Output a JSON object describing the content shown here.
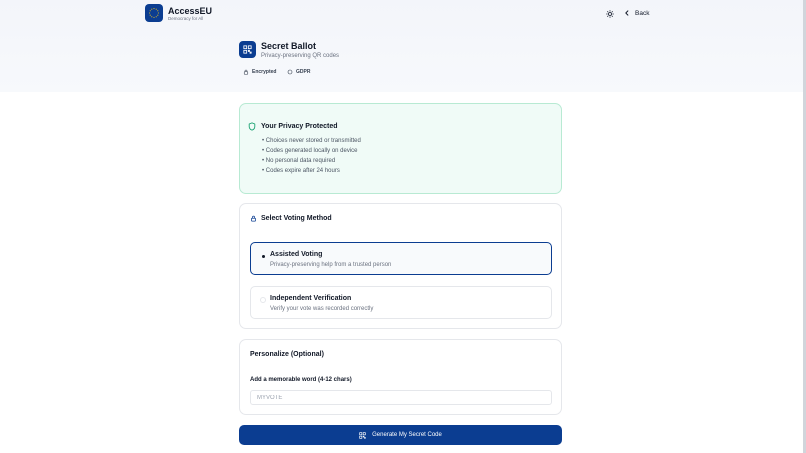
{
  "header": {
    "brand_name": "AccessEU",
    "brand_tagline": "Democracy for All",
    "back_label": "Back"
  },
  "page": {
    "title": "Secret Ballot",
    "subtitle": "Privacy-preserving QR codes",
    "badges": [
      "Encrypted",
      "GDPR"
    ]
  },
  "privacy": {
    "title": "Your Privacy Protected",
    "items": [
      "Choices never stored or transmitted",
      "Codes generated locally on device",
      "No personal data required",
      "Codes expire after 24 hours"
    ]
  },
  "voting_method": {
    "title": "Select Voting Method",
    "options": [
      {
        "label": "Assisted Voting",
        "description": "Privacy-preserving help from a trusted person",
        "selected": true
      },
      {
        "label": "Independent Verification",
        "description": "Verify your vote was recorded correctly",
        "selected": false
      }
    ]
  },
  "personalize": {
    "title": "Personalize (Optional)",
    "field_label": "Add a memorable word (4-12 chars)",
    "placeholder": "MYVOTE",
    "value": ""
  },
  "actions": {
    "generate_label": "Generate My Secret Code"
  },
  "colors": {
    "primary": "#0b3d91",
    "privacy_bg": "#f0fbf7",
    "privacy_border": "#b8ead3",
    "shield": "#0f9d6b"
  },
  "icons": {
    "logo": "eu-stars-icon",
    "theme": "sun-icon",
    "back": "chevron-left-icon",
    "title": "qr-code-icon",
    "encrypted": "lock-icon",
    "gdpr": "circle-icon",
    "privacy": "shield-icon",
    "method": "lock-icon",
    "generate": "qr-code-icon"
  }
}
